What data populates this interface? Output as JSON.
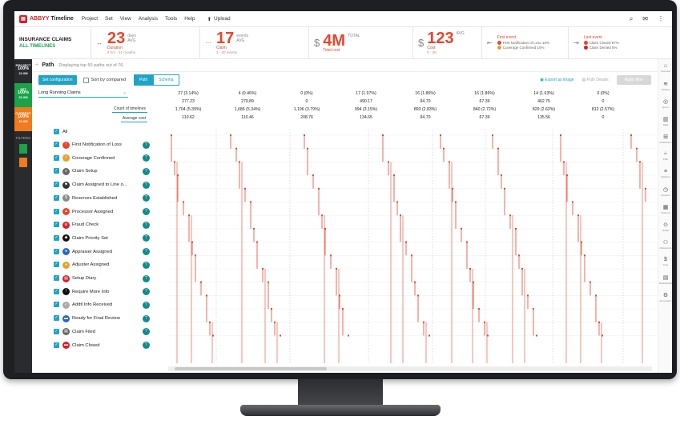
{
  "topbar": {
    "brand": "ABBYY",
    "product": "Timeline",
    "menu": [
      "Project",
      "Set",
      "View",
      "Analysis",
      "Tools",
      "Help"
    ],
    "upload": "Upload"
  },
  "kpis": {
    "claims_title": "INSURANCE CLAIMS",
    "timelines": "ALL TIMELINES",
    "duration": {
      "value": "23",
      "unit_top": "days",
      "unit_bottom": "AVG",
      "label": "Duration",
      "sub": "4 hrs - 31 months"
    },
    "events": {
      "value": "17",
      "unit_top": "events",
      "unit_bottom": "AVG",
      "label": "Claim",
      "sub": "3 - 30 events"
    },
    "total": {
      "value": "4M",
      "currency": "$",
      "unit": "TOTAL",
      "label": "Total cost"
    },
    "avg": {
      "value": "123",
      "currency": "$",
      "unit": "AVG",
      "label": "Cost",
      "sub": "0 - 2K"
    },
    "first_event": {
      "title": "First event",
      "rows": [
        {
          "label": "First Notification of Loss",
          "pct": "10%",
          "color": "#e8452c"
        },
        {
          "label": "Coverage Confirmed",
          "pct": "10%",
          "color": "#e8a02c"
        }
      ]
    },
    "last_event": {
      "title": "Last event",
      "rows": [
        {
          "label": "Claim Closed",
          "pct": "87%",
          "color": "#e8452c"
        },
        {
          "label": "Claim Denied",
          "pct": "5%",
          "color": "#d6202a"
        }
      ]
    }
  },
  "left_strip": [
    {
      "title": "PROJECT",
      "pct": "100%",
      "sub": "21.0M",
      "color": "#2a2b2e"
    },
    {
      "title": "SET",
      "pct": "100%",
      "sub": "21.0M",
      "color": "#1aa34a"
    },
    {
      "title": "CURRENT",
      "pct": "100%",
      "sub": "21.0M",
      "color": "#f07a1e"
    }
  ],
  "filters_label": "FILTERS",
  "path": {
    "title": "Path",
    "subtitle": "Displaying top 50 paths out of 76.",
    "config_button": "Set configuration",
    "sort_label": "Sort by compared",
    "tab_path": "Path",
    "tab_schema": "Schema",
    "export": "Export as image",
    "details": "Path Details",
    "apply": "Apply filter"
  },
  "left_panel": {
    "dropdown": "Long Running Claims",
    "count_label": "Count of timelines",
    "avg_label": "Average cost",
    "all_label": "All",
    "activities": [
      {
        "label": "First Notification of Loss",
        "color": "#e8452c",
        "glyph": "!"
      },
      {
        "label": "Coverage Confirmed",
        "color": "#e8a02c",
        "glyph": "✓"
      },
      {
        "label": "Claim Setup",
        "color": "#666666",
        "glyph": "≡"
      },
      {
        "label": "Claim Assigned to Line o...",
        "color": "#333333",
        "glyph": "⚑"
      },
      {
        "label": "Reserves Established",
        "color": "#888888",
        "glyph": "$"
      },
      {
        "label": "Processor Assigned",
        "color": "#e8452c",
        "glyph": "▲"
      },
      {
        "label": "Fraud Check",
        "color": "#d6202a",
        "glyph": "⊘"
      },
      {
        "label": "Claim Priority Set",
        "color": "#111111",
        "glyph": "◆"
      },
      {
        "label": "Appraiser Assigned",
        "color": "#2a66c8",
        "glyph": "●"
      },
      {
        "label": "Adjuster Assigned",
        "color": "#e8a02c",
        "glyph": "●"
      },
      {
        "label": "Setup Diary",
        "color": "#d6202a",
        "glyph": "▤"
      },
      {
        "label": "Require More Info",
        "color": "#111111",
        "glyph": "!"
      },
      {
        "label": "Addtl Info Received",
        "color": "#aaaaaa",
        "glyph": "✓"
      },
      {
        "label": "Ready for Final Review",
        "color": "#2a66c8",
        "glyph": "▬"
      },
      {
        "label": "Claim Filed",
        "color": "#666666",
        "glyph": "▤"
      },
      {
        "label": "Claim Closed",
        "color": "#d6202a",
        "glyph": "▬"
      }
    ]
  },
  "stats": {
    "columns": [
      {
        "count": "27 (3.14%)",
        "avg": "277.23",
        "count2": "1,704 (5.39%)",
        "avg2": "110.62"
      },
      {
        "count": "4 (0.46%)",
        "avg": "279.89",
        "count2": "1,686 (5.34%)",
        "avg2": "110.46"
      },
      {
        "count": "0 (0%)",
        "avg": "0",
        "count2": "1,196 (3.79%)",
        "avg2": "208.76"
      },
      {
        "count": "17 (1.97%)",
        "avg": "490.17",
        "count2": "994 (3.15%)",
        "avg2": "134.65"
      },
      {
        "count": "16 (1.86%)",
        "avg": "94.70",
        "count2": "893 (2.83%)",
        "avg2": "94.70"
      },
      {
        "count": "16 (1.86%)",
        "avg": "67.39",
        "count2": "840 (2.72%)",
        "avg2": "67.39"
      },
      {
        "count": "14 (1.63%)",
        "avg": "462.75",
        "count2": "829 (2.62%)",
        "avg2": "135.56"
      },
      {
        "count": "0 (0%)",
        "avg": "0",
        "count2": "812 (2.57%)",
        "avg2": "0"
      }
    ]
  },
  "right_rail": [
    "Overview",
    "Timeline",
    "Query",
    "Stats",
    "Distribution",
    "Path",
    "Patterns",
    "Duration",
    "Schema",
    "Guide",
    "Influencers",
    "Cost",
    "Dashboards",
    "Automation"
  ],
  "colors": {
    "accent": "#1fa4c6",
    "path": "#e8452c",
    "kpi": "#e8452c"
  }
}
